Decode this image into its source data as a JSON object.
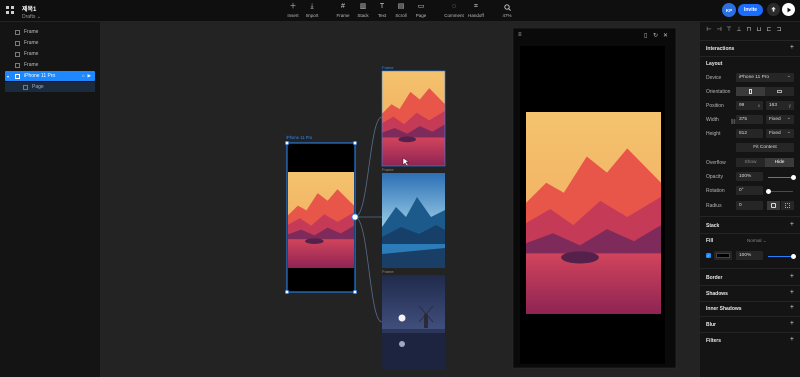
{
  "project": {
    "title": "제목1",
    "subtitle": "Drafts ⌄"
  },
  "toolbar": {
    "tools": [
      {
        "label": "Insert",
        "icon": "plus-icon"
      },
      {
        "label": "Import",
        "icon": "download-icon"
      },
      {
        "label": "Frame",
        "icon": "frame-icon"
      },
      {
        "label": "Stack",
        "icon": "stack-icon"
      },
      {
        "label": "Text",
        "icon": "text-icon"
      },
      {
        "label": "Scroll",
        "icon": "scroll-icon"
      },
      {
        "label": "Page",
        "icon": "page-icon"
      },
      {
        "label": "Comment",
        "icon": "comment-icon"
      },
      {
        "label": "Handoff",
        "icon": "handoff-icon"
      },
      {
        "label": "47%",
        "icon": "search-icon"
      }
    ],
    "avatar": "KP",
    "invite": "Invite"
  },
  "layers": [
    {
      "label": "Frame"
    },
    {
      "label": "Frame"
    },
    {
      "label": "Frame"
    },
    {
      "label": "Frame"
    },
    {
      "label": "iPhone 11 Pro"
    },
    {
      "label": "Page"
    }
  ],
  "canvas": {
    "device_label": "iPhone 11 Pro",
    "frame_labels": [
      "Frame",
      "Frame",
      "Frame"
    ]
  },
  "panel": {
    "sections": {
      "interactions": "Interactions",
      "layout": "Layout",
      "stack": "Stack",
      "fill": "Fill",
      "border": "Border",
      "shadows": "Shadows",
      "inner_shadows": "Inner Shadows",
      "blur": "Blur",
      "filters": "Filters"
    },
    "device": {
      "label": "Device",
      "value": "iPhone 11 Pro"
    },
    "orientation": {
      "label": "Orientation"
    },
    "position": {
      "label": "Position",
      "x": "99",
      "x_suffix": "x",
      "y": "163",
      "y_suffix": "y"
    },
    "width": {
      "label": "Width",
      "value": "375",
      "mode": "Fixed"
    },
    "height": {
      "label": "Height",
      "value": "812",
      "mode": "Fixed"
    },
    "fit_content": "Fit Content",
    "overflow": {
      "label": "Overflow",
      "show": "Show",
      "hide": "Hide"
    },
    "opacity": {
      "label": "Opacity",
      "value": "100%",
      "level": 1.0
    },
    "rotation": {
      "label": "Rotation",
      "value": "0°",
      "level": 0.0
    },
    "radius": {
      "label": "Radius",
      "value": "0"
    },
    "fill": {
      "blend": "Normal ⌄",
      "color": "#000000",
      "opacity": "100%",
      "level": 1.0
    }
  }
}
